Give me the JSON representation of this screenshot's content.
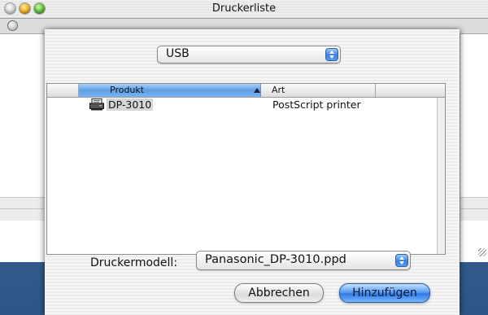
{
  "window": {
    "title": "Druckerliste"
  },
  "connection_popup": {
    "value": "USB"
  },
  "table": {
    "columns": [
      "Produkt",
      "Art"
    ],
    "rows": [
      {
        "name": "DP-3010",
        "type": "PostScript printer"
      }
    ]
  },
  "model": {
    "label": "Druckermodell:",
    "value": "Panasonic_DP-3010.ppd"
  },
  "buttons": {
    "cancel": "Abbrechen",
    "add": "Hinzufügen"
  },
  "icons": {
    "printer": "printer-icon",
    "sort": "sort-ascending-icon",
    "popup_arrows": "updown-arrows-icon"
  },
  "colors": {
    "accent": "#3d7fd8",
    "desktop": "#3a5f8c"
  }
}
